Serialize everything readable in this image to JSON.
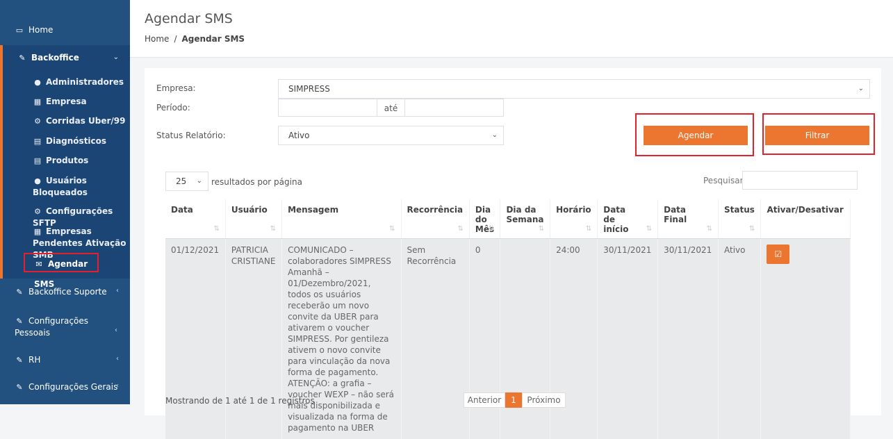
{
  "sidebar": {
    "home": "Home",
    "backoffice": "Backoffice",
    "items": [
      {
        "label": "Administradores",
        "icon": "user-icon"
      },
      {
        "label": "Empresa",
        "icon": "building-icon"
      },
      {
        "label": "Corridas Uber/99",
        "icon": "cogs-icon"
      },
      {
        "label": "Diagnósticos",
        "icon": "list-icon"
      },
      {
        "label": "Produtos",
        "icon": "list-icon"
      },
      {
        "label": "Usuários Bloqueados",
        "icon": "user-icon"
      },
      {
        "label": "Configurações SFTP",
        "icon": "cogs-icon"
      },
      {
        "label": "Empresas Pendentes Ativação SMB",
        "icon": "building-icon"
      },
      {
        "label": "Agendar SMS",
        "icon": "envelope-icon"
      }
    ],
    "sections": [
      "Backoffice Suporte",
      "Configurações Pessoais",
      "RH",
      "Configurações Gerais"
    ]
  },
  "header": {
    "title": "Agendar SMS",
    "breadcrumb_home": "Home",
    "breadcrumb_sep": "/",
    "breadcrumb_current": "Agendar SMS"
  },
  "filters": {
    "empresa_label": "Empresa:",
    "empresa_value": "SIMPRESS",
    "periodo_label": "Período:",
    "ate_label": "até",
    "status_label": "Status Relatório:",
    "status_value": "Ativo",
    "agendar_label": "Agendar",
    "filtrar_label": "Filtrar"
  },
  "table_controls": {
    "page_size": "25",
    "page_size_suffix": "resultados por página",
    "search_label": "Pesquisar"
  },
  "table": {
    "columns": [
      "Data",
      "Usuário",
      "Mensagem",
      "Recorrência",
      "Dia do Mês",
      "Dia da Semana",
      "Horário",
      "Data de início",
      "Data Final",
      "Status",
      "Ativar/Desativar"
    ],
    "rows": [
      {
        "data": "01/12/2021",
        "usuario": "PATRICIA CRISTIANE",
        "mensagem": "COMUNICADO – colaboradores SIMPRESS Amanhã – 01/Dezembro/2021, todos os usuários receberão um novo convite da UBER para ativarem o voucher SIMPRESS. Por gentileza ativem o novo convite para vinculação da nova forma de pagamento. ATENÇÃO: a grafia – voucher WEXP – não será mais disponibilizada e visualizada na forma de pagamento na UBER",
        "recorrencia": "Sem Recorrência",
        "dia_mes": "0",
        "dia_semana": "",
        "horario": "24:00",
        "data_inicio": "30/11/2021",
        "data_final": "30/11/2021",
        "status": "Ativo"
      }
    ]
  },
  "footer": {
    "info": "Mostrando de 1 até 1 de 1 registros",
    "prev": "Anterior",
    "page": "1",
    "next": "Próximo"
  },
  "colors": {
    "sidebar": "#22507f",
    "accent": "#ec7530",
    "highlight": "#e3202b"
  }
}
